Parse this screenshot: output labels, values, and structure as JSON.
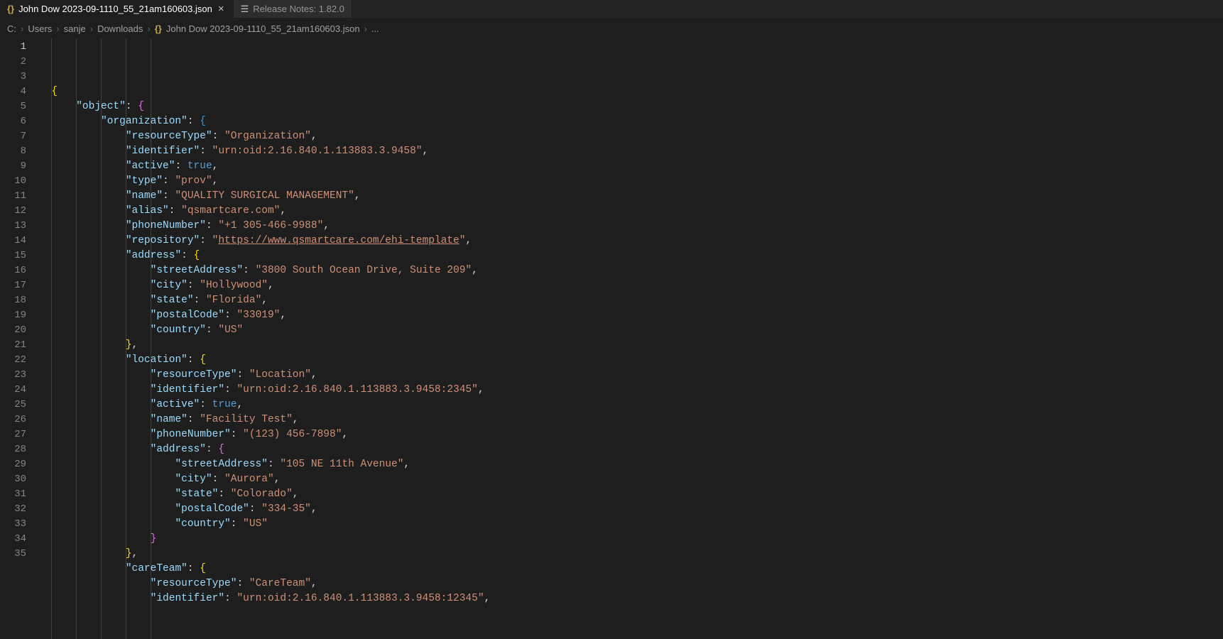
{
  "tabs": [
    {
      "icon": "braces",
      "label": "John Dow 2023-09-1110_55_21am160603.json",
      "active": true,
      "closeable": true
    },
    {
      "icon": "preview",
      "label": "Release Notes: 1.82.0",
      "active": false,
      "closeable": false
    }
  ],
  "breadcrumbs": {
    "segments": [
      "C:",
      "Users",
      "sanje",
      "Downloads"
    ],
    "file": "John Dow 2023-09-1110_55_21am160603.json",
    "trailing": "..."
  },
  "code": {
    "lines": [
      {
        "n": 1,
        "indent": 0,
        "tokens": [
          {
            "t": "b0",
            "v": "{"
          }
        ]
      },
      {
        "n": 2,
        "indent": 1,
        "tokens": [
          {
            "t": "k",
            "v": "\"object\""
          },
          {
            "t": "p",
            "v": ": "
          },
          {
            "t": "b1",
            "v": "{"
          }
        ]
      },
      {
        "n": 3,
        "indent": 2,
        "tokens": [
          {
            "t": "k",
            "v": "\"organization\""
          },
          {
            "t": "p",
            "v": ": "
          },
          {
            "t": "b2",
            "v": "{"
          }
        ]
      },
      {
        "n": 4,
        "indent": 3,
        "tokens": [
          {
            "t": "k",
            "v": "\"resourceType\""
          },
          {
            "t": "p",
            "v": ": "
          },
          {
            "t": "s",
            "v": "\"Organization\""
          },
          {
            "t": "p",
            "v": ","
          }
        ]
      },
      {
        "n": 5,
        "indent": 3,
        "tokens": [
          {
            "t": "k",
            "v": "\"identifier\""
          },
          {
            "t": "p",
            "v": ": "
          },
          {
            "t": "s",
            "v": "\"urn:oid:2.16.840.1.113883.3.9458\""
          },
          {
            "t": "p",
            "v": ","
          }
        ]
      },
      {
        "n": 6,
        "indent": 3,
        "tokens": [
          {
            "t": "k",
            "v": "\"active\""
          },
          {
            "t": "p",
            "v": ": "
          },
          {
            "t": "b",
            "v": "true"
          },
          {
            "t": "p",
            "v": ","
          }
        ]
      },
      {
        "n": 7,
        "indent": 3,
        "tokens": [
          {
            "t": "k",
            "v": "\"type\""
          },
          {
            "t": "p",
            "v": ": "
          },
          {
            "t": "s",
            "v": "\"prov\""
          },
          {
            "t": "p",
            "v": ","
          }
        ]
      },
      {
        "n": 8,
        "indent": 3,
        "tokens": [
          {
            "t": "k",
            "v": "\"name\""
          },
          {
            "t": "p",
            "v": ": "
          },
          {
            "t": "s",
            "v": "\"QUALITY SURGICAL MANAGEMENT\""
          },
          {
            "t": "p",
            "v": ","
          }
        ]
      },
      {
        "n": 9,
        "indent": 3,
        "tokens": [
          {
            "t": "k",
            "v": "\"alias\""
          },
          {
            "t": "p",
            "v": ": "
          },
          {
            "t": "s",
            "v": "\"qsmartcare.com\""
          },
          {
            "t": "p",
            "v": ","
          }
        ]
      },
      {
        "n": 10,
        "indent": 3,
        "tokens": [
          {
            "t": "k",
            "v": "\"phoneNumber\""
          },
          {
            "t": "p",
            "v": ": "
          },
          {
            "t": "s",
            "v": "\"+1 305-466-9988\""
          },
          {
            "t": "p",
            "v": ","
          }
        ]
      },
      {
        "n": 11,
        "indent": 3,
        "tokens": [
          {
            "t": "k",
            "v": "\"repository\""
          },
          {
            "t": "p",
            "v": ": "
          },
          {
            "t": "s",
            "v": "\""
          },
          {
            "t": "surl",
            "v": "https://www.qsmartcare.com/ehi-template"
          },
          {
            "t": "s",
            "v": "\""
          },
          {
            "t": "p",
            "v": ","
          }
        ]
      },
      {
        "n": 12,
        "indent": 3,
        "tokens": [
          {
            "t": "k",
            "v": "\"address\""
          },
          {
            "t": "p",
            "v": ": "
          },
          {
            "t": "b0",
            "v": "{"
          }
        ]
      },
      {
        "n": 13,
        "indent": 4,
        "tokens": [
          {
            "t": "k",
            "v": "\"streetAddress\""
          },
          {
            "t": "p",
            "v": ": "
          },
          {
            "t": "s",
            "v": "\"3800 South Ocean Drive, Suite 209\""
          },
          {
            "t": "p",
            "v": ","
          }
        ]
      },
      {
        "n": 14,
        "indent": 4,
        "tokens": [
          {
            "t": "k",
            "v": "\"city\""
          },
          {
            "t": "p",
            "v": ": "
          },
          {
            "t": "s",
            "v": "\"Hollywood\""
          },
          {
            "t": "p",
            "v": ","
          }
        ]
      },
      {
        "n": 15,
        "indent": 4,
        "tokens": [
          {
            "t": "k",
            "v": "\"state\""
          },
          {
            "t": "p",
            "v": ": "
          },
          {
            "t": "s",
            "v": "\"Florida\""
          },
          {
            "t": "p",
            "v": ","
          }
        ]
      },
      {
        "n": 16,
        "indent": 4,
        "tokens": [
          {
            "t": "k",
            "v": "\"postalCode\""
          },
          {
            "t": "p",
            "v": ": "
          },
          {
            "t": "s",
            "v": "\"33019\""
          },
          {
            "t": "p",
            "v": ","
          }
        ]
      },
      {
        "n": 17,
        "indent": 4,
        "tokens": [
          {
            "t": "k",
            "v": "\"country\""
          },
          {
            "t": "p",
            "v": ": "
          },
          {
            "t": "s",
            "v": "\"US\""
          }
        ]
      },
      {
        "n": 18,
        "indent": 3,
        "tokens": [
          {
            "t": "b0",
            "v": "}"
          },
          {
            "t": "p",
            "v": ","
          }
        ]
      },
      {
        "n": 19,
        "indent": 3,
        "tokens": [
          {
            "t": "k",
            "v": "\"location\""
          },
          {
            "t": "p",
            "v": ": "
          },
          {
            "t": "b0",
            "v": "{"
          }
        ]
      },
      {
        "n": 20,
        "indent": 4,
        "tokens": [
          {
            "t": "k",
            "v": "\"resourceType\""
          },
          {
            "t": "p",
            "v": ": "
          },
          {
            "t": "s",
            "v": "\"Location\""
          },
          {
            "t": "p",
            "v": ","
          }
        ]
      },
      {
        "n": 21,
        "indent": 4,
        "tokens": [
          {
            "t": "k",
            "v": "\"identifier\""
          },
          {
            "t": "p",
            "v": ": "
          },
          {
            "t": "s",
            "v": "\"urn:oid:2.16.840.1.113883.3.9458:2345\""
          },
          {
            "t": "p",
            "v": ","
          }
        ]
      },
      {
        "n": 22,
        "indent": 4,
        "tokens": [
          {
            "t": "k",
            "v": "\"active\""
          },
          {
            "t": "p",
            "v": ": "
          },
          {
            "t": "b",
            "v": "true"
          },
          {
            "t": "p",
            "v": ","
          }
        ]
      },
      {
        "n": 23,
        "indent": 4,
        "tokens": [
          {
            "t": "k",
            "v": "\"name\""
          },
          {
            "t": "p",
            "v": ": "
          },
          {
            "t": "s",
            "v": "\"Facility Test\""
          },
          {
            "t": "p",
            "v": ","
          }
        ]
      },
      {
        "n": 24,
        "indent": 4,
        "tokens": [
          {
            "t": "k",
            "v": "\"phoneNumber\""
          },
          {
            "t": "p",
            "v": ": "
          },
          {
            "t": "s",
            "v": "\"(123) 456-7898\""
          },
          {
            "t": "p",
            "v": ","
          }
        ]
      },
      {
        "n": 25,
        "indent": 4,
        "tokens": [
          {
            "t": "k",
            "v": "\"address\""
          },
          {
            "t": "p",
            "v": ": "
          },
          {
            "t": "b1",
            "v": "{"
          }
        ]
      },
      {
        "n": 26,
        "indent": 5,
        "tokens": [
          {
            "t": "k",
            "v": "\"streetAddress\""
          },
          {
            "t": "p",
            "v": ": "
          },
          {
            "t": "s",
            "v": "\"105 NE 11th Avenue\""
          },
          {
            "t": "p",
            "v": ","
          }
        ]
      },
      {
        "n": 27,
        "indent": 5,
        "tokens": [
          {
            "t": "k",
            "v": "\"city\""
          },
          {
            "t": "p",
            "v": ": "
          },
          {
            "t": "s",
            "v": "\"Aurora\""
          },
          {
            "t": "p",
            "v": ","
          }
        ]
      },
      {
        "n": 28,
        "indent": 5,
        "tokens": [
          {
            "t": "k",
            "v": "\"state\""
          },
          {
            "t": "p",
            "v": ": "
          },
          {
            "t": "s",
            "v": "\"Colorado\""
          },
          {
            "t": "p",
            "v": ","
          }
        ]
      },
      {
        "n": 29,
        "indent": 5,
        "tokens": [
          {
            "t": "k",
            "v": "\"postalCode\""
          },
          {
            "t": "p",
            "v": ": "
          },
          {
            "t": "s",
            "v": "\"334-35\""
          },
          {
            "t": "p",
            "v": ","
          }
        ]
      },
      {
        "n": 30,
        "indent": 5,
        "tokens": [
          {
            "t": "k",
            "v": "\"country\""
          },
          {
            "t": "p",
            "v": ": "
          },
          {
            "t": "s",
            "v": "\"US\""
          }
        ]
      },
      {
        "n": 31,
        "indent": 4,
        "tokens": [
          {
            "t": "b1",
            "v": "}"
          }
        ]
      },
      {
        "n": 32,
        "indent": 3,
        "tokens": [
          {
            "t": "b0",
            "v": "}"
          },
          {
            "t": "p",
            "v": ","
          }
        ]
      },
      {
        "n": 33,
        "indent": 3,
        "tokens": [
          {
            "t": "k",
            "v": "\"careTeam\""
          },
          {
            "t": "p",
            "v": ": "
          },
          {
            "t": "b0",
            "v": "{"
          }
        ]
      },
      {
        "n": 34,
        "indent": 4,
        "tokens": [
          {
            "t": "k",
            "v": "\"resourceType\""
          },
          {
            "t": "p",
            "v": ": "
          },
          {
            "t": "s",
            "v": "\"CareTeam\""
          },
          {
            "t": "p",
            "v": ","
          }
        ]
      },
      {
        "n": 35,
        "indent": 4,
        "tokens": [
          {
            "t": "k",
            "v": "\"identifier\""
          },
          {
            "t": "p",
            "v": ": "
          },
          {
            "t": "s",
            "v": "\"urn:oid:2.16.840.1.113883.3.9458:12345\""
          },
          {
            "t": "p",
            "v": ","
          }
        ]
      }
    ]
  }
}
